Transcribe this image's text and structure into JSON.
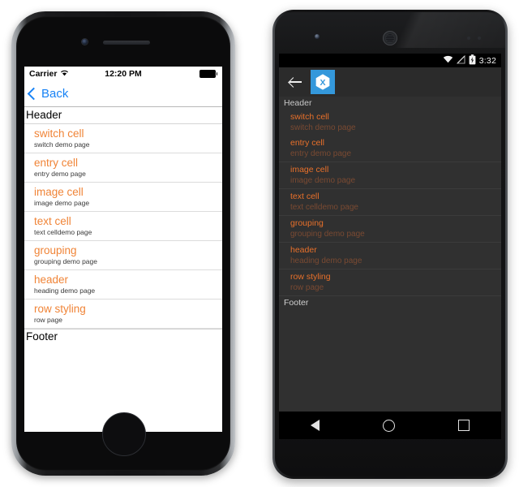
{
  "colors": {
    "ios_accent_orange": "#F08437",
    "ios_link_blue": "#1782F5",
    "android_accent_orange": "#E8702A",
    "android_detail_orange": "#7A4A32",
    "xamarin_blue": "#3498DB",
    "android_screen_bg": "#303030",
    "ios_screen_bg": "#FFFFFF"
  },
  "ios": {
    "status_bar": {
      "carrier": "Carrier",
      "wifi_icon": "wifi-icon",
      "time": "12:20 PM",
      "battery_icon": "battery-full-icon"
    },
    "nav_bar": {
      "back_label": "Back",
      "back_icon": "chevron-left-icon"
    },
    "list": {
      "header": "Header",
      "footer": "Footer",
      "rows": [
        {
          "title": "switch cell",
          "detail": "switch demo page"
        },
        {
          "title": "entry cell",
          "detail": "entry demo page"
        },
        {
          "title": "image cell",
          "detail": "image demo page"
        },
        {
          "title": "text cell",
          "detail": "text celldemo page"
        },
        {
          "title": "grouping",
          "detail": "grouping demo page"
        },
        {
          "title": "header",
          "detail": "heading demo page"
        },
        {
          "title": "row styling",
          "detail": "row page"
        }
      ]
    }
  },
  "android": {
    "status_bar": {
      "wifi_icon": "wifi-icon",
      "signal_icon": "cellular-signal-off-icon",
      "battery_icon": "battery-charging-icon",
      "time": "3:32"
    },
    "action_bar": {
      "back_icon": "arrow-back-icon",
      "app_logo": "xamarin-logo-icon"
    },
    "list": {
      "header": "Header",
      "footer": "Footer",
      "rows": [
        {
          "title": "switch cell",
          "detail": "switch demo page"
        },
        {
          "title": "entry cell",
          "detail": "entry demo page"
        },
        {
          "title": "image cell",
          "detail": "image demo page"
        },
        {
          "title": "text cell",
          "detail": "text celldemo page"
        },
        {
          "title": "grouping",
          "detail": "grouping demo page"
        },
        {
          "title": "header",
          "detail": "heading demo page"
        },
        {
          "title": "row styling",
          "detail": "row page"
        }
      ]
    },
    "nav_bar": {
      "back_icon": "nav-back-triangle-icon",
      "home_icon": "nav-home-circle-icon",
      "recents_icon": "nav-recents-square-icon"
    }
  }
}
